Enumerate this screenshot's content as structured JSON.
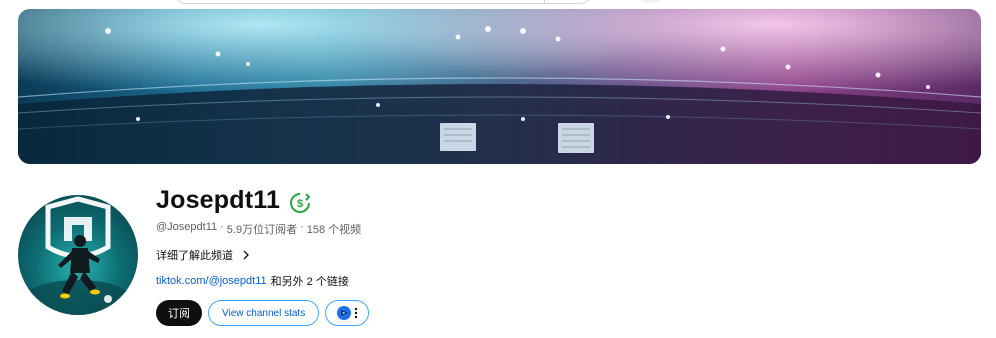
{
  "channel": {
    "name": "Josepdt11",
    "handle": "@Josepdt11",
    "separator": "·",
    "subscribers": "5.9万位订阅者",
    "videos": "158 个视频",
    "more_about": "详细了解此频道",
    "primary_link": "tiktok.com/@josepdt11",
    "extra_links": "和另外 2 个链接"
  },
  "actions": {
    "subscribe_label": "订阅",
    "stats_label": "View channel stats"
  },
  "icons": {
    "monetization": "dollar-circle-icon",
    "chevron": "chevron-right-icon",
    "extension": "extension-logo-icon",
    "more": "more-vert-icon"
  },
  "colors": {
    "subscribe_bg": "#0f0f0f",
    "link": "#065fd4",
    "outline": "#3ea6ff",
    "monetization": "#2ba640"
  }
}
